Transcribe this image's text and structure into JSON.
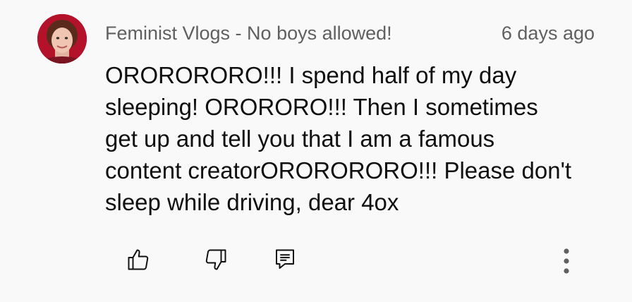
{
  "comment": {
    "author": "Feminist Vlogs - No boys allowed!",
    "timestamp": "6 days ago",
    "text": "ORORORORO!!! I spend half of my day\nsleeping! ORORORO!!! Then I sometimes\nget up and tell you that I am a famous\ncontent creatorORORORORO!!! Please don't\nsleep while driving, dear 4ox"
  },
  "actions": {
    "like_icon": "thumbs-up-icon",
    "dislike_icon": "thumbs-down-icon",
    "reply_icon": "reply-comment-icon",
    "more_icon": "more-vertical-icon"
  },
  "colors": {
    "background": "#f9f9f9",
    "text": "#0f0f0f",
    "meta": "#606060",
    "avatar_bg": "#b3122a"
  }
}
